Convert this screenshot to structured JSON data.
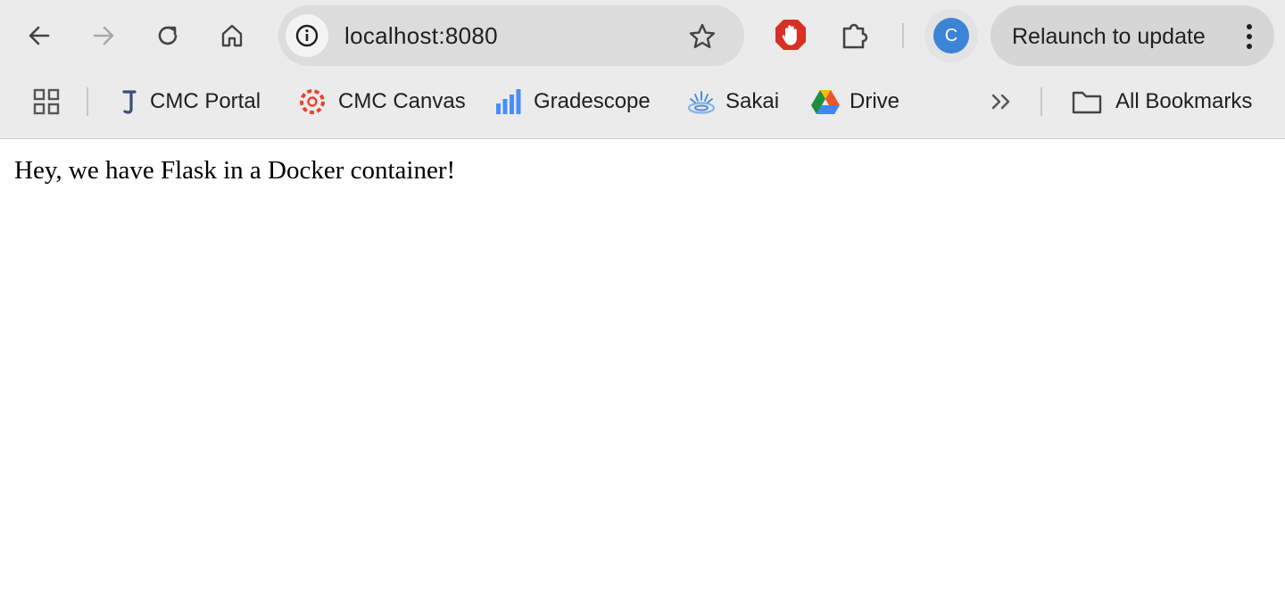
{
  "toolbar": {
    "icons": [
      "back-arrow-icon",
      "forward-arrow-icon",
      "reload-icon",
      "home-icon"
    ],
    "url": "localhost:8080",
    "site_info_icon": "info-icon",
    "bookmark_star_icon": "star-outline-icon",
    "extensions": [
      "adblock-hand-icon",
      "puzzle-piece-icon"
    ],
    "profile_initial": "C",
    "relaunch_label": "Relaunch to update"
  },
  "bookmarks_bar": {
    "apps_icon": "grid-icon",
    "items": [
      {
        "label": "CMC Portal",
        "icon": "j-logo-icon"
      },
      {
        "label": "CMC Canvas",
        "icon": "canvas-logo-icon"
      },
      {
        "label": "Gradescope",
        "icon": "gradescope-logo-icon"
      },
      {
        "label": "Sakai",
        "icon": "sakai-logo-icon"
      },
      {
        "label": "Drive",
        "icon": "google-drive-icon"
      }
    ],
    "overflow_icon": "double-chevron-icon",
    "all_bookmarks_label": "All Bookmarks"
  },
  "page": {
    "body_text": "Hey, we have Flask in a Docker container!"
  },
  "colors": {
    "chrome_bg": "#ebebeb",
    "omnibox_bg": "#dcdcdc",
    "relaunch_bg": "#d6d6d6",
    "avatar": "#3c84d6",
    "adblock_red": "#d93025",
    "gradescope_blue": "#4a8df6"
  }
}
